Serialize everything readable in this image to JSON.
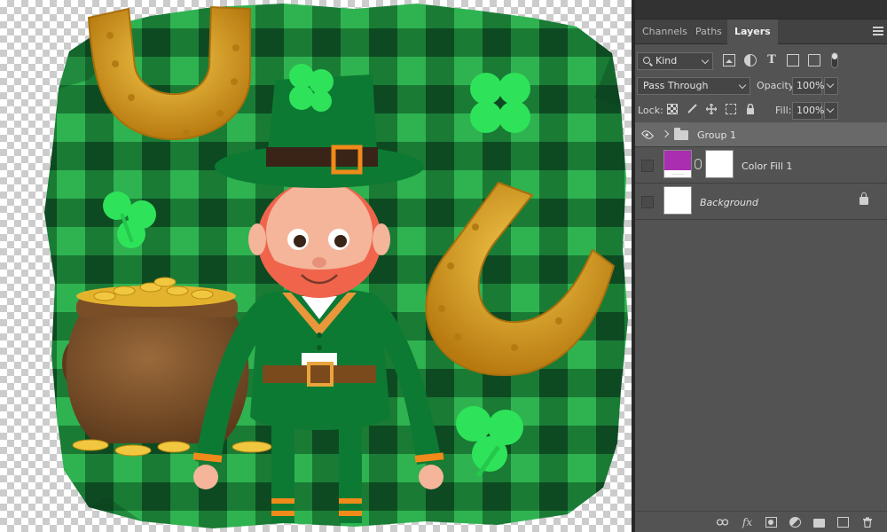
{
  "panel": {
    "tabs": [
      {
        "label": "Channels"
      },
      {
        "label": "Paths"
      },
      {
        "label": "Layers"
      }
    ],
    "filter": {
      "kind_label": "Kind"
    },
    "blend": {
      "mode": "Pass Through",
      "opacity_label": "Opacity:",
      "opacity_value": "100%"
    },
    "lock": {
      "label": "Lock:",
      "fill_label": "Fill:",
      "fill_value": "100%"
    },
    "layers": [
      {
        "name": "Group 1",
        "type": "group",
        "visible": true,
        "selected": true
      },
      {
        "name": "Color Fill 1",
        "type": "fill",
        "visible": false,
        "color": "#a92fb0"
      },
      {
        "name": "Background",
        "type": "background",
        "visible": false,
        "locked": true
      }
    ],
    "bottom_icons": {
      "link": "link-icon",
      "fx": "fx",
      "mask": "mask-icon",
      "adjustment": "adjustment-icon",
      "group": "folder-icon",
      "new_layer": "new-layer-icon",
      "delete": "trash-icon"
    }
  },
  "colors": {
    "panel_bg": "#535353",
    "selected_row": "#696969",
    "plaid_green": "#1f8a3a",
    "clover": "#2ee35a",
    "gold": "#d9a520"
  }
}
